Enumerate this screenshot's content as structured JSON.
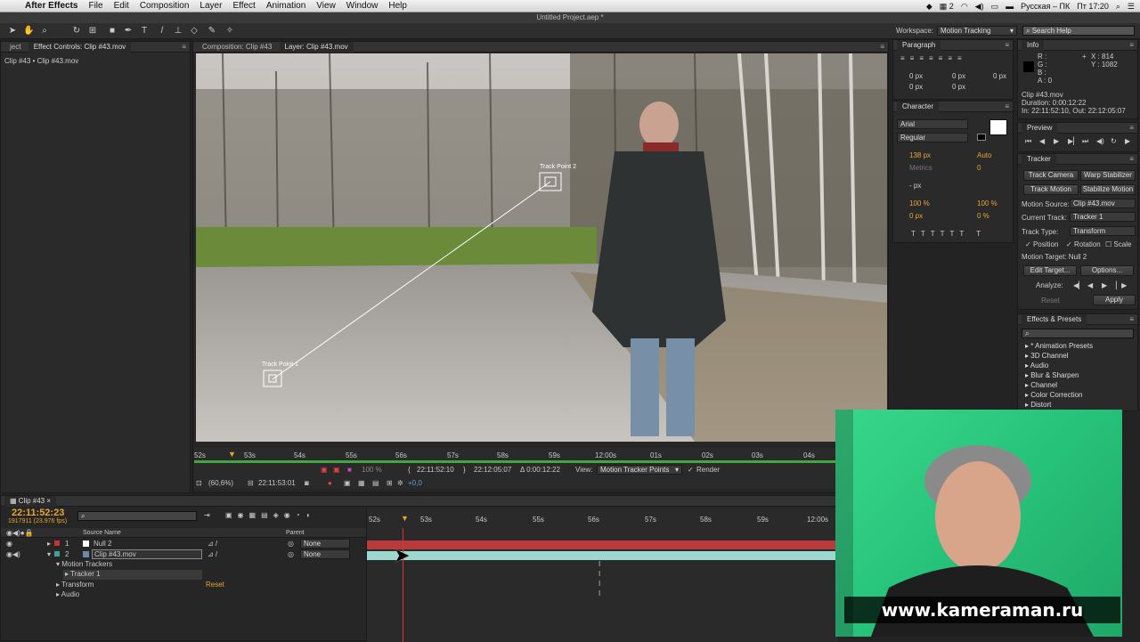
{
  "menubar": {
    "app_name": "After Effects",
    "menus": [
      "File",
      "Edit",
      "Composition",
      "Layer",
      "Effect",
      "Animation",
      "View",
      "Window",
      "Help"
    ],
    "input_source": "Русская – ПК",
    "clock": "Пт 17:20",
    "spaces_number": "2"
  },
  "window_title": "Untitled Project.aep *",
  "toolbar": {
    "workspace_label": "Workspace:",
    "workspace_value": "Motion Tracking",
    "search_placeholder": "Search Help"
  },
  "left_panel": {
    "tab_prefix": "ject",
    "tab_effect_controls": "Effect Controls: Clip #43.mov",
    "breadcrumb": "Clip #43 • Clip #43.mov"
  },
  "viewer_tabs": {
    "composition": "Composition: Clip #43",
    "layer": "Layer: Clip #43.mov"
  },
  "track_points": {
    "point1": "Track Point 1",
    "point2": "Track Point 2"
  },
  "viewer_ruler": {
    "ticks": [
      "52s",
      "53s",
      "54s",
      "55s",
      "56s",
      "57s",
      "58s",
      "59s",
      "12:00s",
      "01s",
      "02s",
      "03s",
      "04s"
    ]
  },
  "viewer_controls": {
    "in_time": "22:11:52:10",
    "out_time": "22:12:05:07",
    "duration": "Δ 0:00:12:22",
    "view_label": "View:",
    "view_value": "Motion Tracker Points",
    "render_label": "Render",
    "zoom": "(60,6%)",
    "timecode": "22:11:53:01",
    "exposure": "+0,0",
    "opacity": "100 %"
  },
  "paragraph": {
    "title": "Paragraph",
    "values": [
      "0 px",
      "0 px",
      "0 px",
      "0 px",
      "0 px"
    ]
  },
  "character": {
    "title": "Character",
    "font": "Arial",
    "style": "Regular",
    "size": "138 px",
    "leading": "Auto",
    "kerning": "Metrics",
    "tracking": "0",
    "stroke": "- px",
    "vscale": "100 %",
    "hscale": "100 %",
    "baseline": "0 px",
    "tsume": "0 %"
  },
  "info": {
    "title": "Info",
    "r": "R :",
    "g": "G :",
    "b": "B :",
    "a": "A : 0",
    "x": "X : 814",
    "y": "Y : 1082",
    "clip": "Clip #43.mov",
    "duration": "Duration: 0:00:12:22",
    "inout": "In: 22:11:52:10, Out: 22:12:05:07"
  },
  "preview": {
    "title": "Preview"
  },
  "tracker": {
    "title": "Tracker",
    "track_camera": "Track Camera",
    "warp_stabilizer": "Warp Stabilizer",
    "track_motion": "Track Motion",
    "stabilize_motion": "Stabilize Motion",
    "motion_source_label": "Motion Source:",
    "motion_source_value": "Clip #43.mov",
    "current_track_label": "Current Track:",
    "current_track_value": "Tracker 1",
    "track_type_label": "Track Type:",
    "track_type_value": "Transform",
    "position": "Position",
    "rotation": "Rotation",
    "scale": "Scale",
    "motion_target": "Motion Target: Null 2",
    "edit_target": "Edit Target...",
    "options": "Options...",
    "analyze": "Analyze:",
    "reset": "Reset",
    "apply": "Apply"
  },
  "effects_presets": {
    "title": "Effects & Presets",
    "items": [
      "* Animation Presets",
      "3D Channel",
      "Audio",
      "Blur & Sharpen",
      "Channel",
      "Color Correction",
      "Distort"
    ]
  },
  "timeline": {
    "tab": "Clip #43",
    "current_time": "22:11:52:23",
    "frame_info": "1917911 (23.976 fps)",
    "col_source": "Source Name",
    "col_parent": "Parent",
    "ruler_ticks": [
      "52s",
      "53s",
      "54s",
      "55s",
      "56s",
      "57s",
      "58s",
      "59s",
      "12:00s"
    ],
    "layers": [
      {
        "num": "1",
        "name": "Null 2",
        "parent": "None",
        "color": "#c83232"
      },
      {
        "num": "2",
        "name": "Clip #43.mov",
        "parent": "None",
        "color": "#3aa0a0"
      }
    ],
    "props": {
      "motion_trackers": "Motion Trackers",
      "tracker1": "Tracker 1",
      "transform": "Transform",
      "reset": "Reset",
      "audio": "Audio"
    }
  },
  "watermark": "www.kameraman.ru"
}
